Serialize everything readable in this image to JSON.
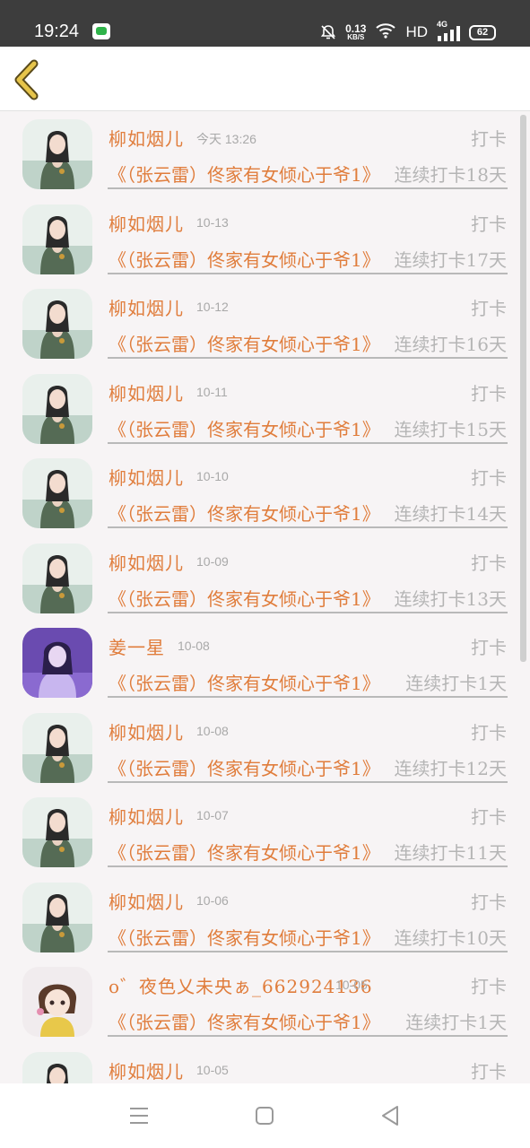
{
  "status_bar": {
    "time": "19:24",
    "net_speed_value": "0.13",
    "net_speed_unit": "KB/S",
    "hd": "HD",
    "network": "4G",
    "battery": "62"
  },
  "colors": {
    "accent": "#e07d3c",
    "muted": "#b5b5b5",
    "back_arrow": "#e6c44a"
  },
  "checkin_label": "打卡",
  "rows": [
    {
      "name": "柳如烟儿",
      "date": "今天 13:26",
      "title": "《（张云雷）佟家有女倾心于爷1》",
      "streak": "连续打卡18天",
      "avatar": "woman-portrait"
    },
    {
      "name": "柳如烟儿",
      "date": "10-13",
      "title": "《（张云雷）佟家有女倾心于爷1》",
      "streak": "连续打卡17天",
      "avatar": "woman-portrait"
    },
    {
      "name": "柳如烟儿",
      "date": "10-12",
      "title": "《（张云雷）佟家有女倾心于爷1》",
      "streak": "连续打卡16天",
      "avatar": "woman-portrait"
    },
    {
      "name": "柳如烟儿",
      "date": "10-11",
      "title": "《（张云雷）佟家有女倾心于爷1》",
      "streak": "连续打卡15天",
      "avatar": "woman-portrait"
    },
    {
      "name": "柳如烟儿",
      "date": "10-10",
      "title": "《（张云雷）佟家有女倾心于爷1》",
      "streak": "连续打卡14天",
      "avatar": "woman-portrait"
    },
    {
      "name": "柳如烟儿",
      "date": "10-09",
      "title": "《（张云雷）佟家有女倾心于爷1》",
      "streak": "连续打卡13天",
      "avatar": "woman-portrait"
    },
    {
      "name": "姜一星",
      "date": "10-08",
      "title": "《（张云雷）佟家有女倾心于爷1》",
      "streak": "连续打卡1天",
      "avatar": "purple-portrait"
    },
    {
      "name": "柳如烟儿",
      "date": "10-08",
      "title": "《（张云雷）佟家有女倾心于爷1》",
      "streak": "连续打卡12天",
      "avatar": "woman-portrait"
    },
    {
      "name": "柳如烟儿",
      "date": "10-07",
      "title": "《（张云雷）佟家有女倾心于爷1》",
      "streak": "连续打卡11天",
      "avatar": "woman-portrait"
    },
    {
      "name": "柳如烟儿",
      "date": "10-06",
      "title": "《（张云雷）佟家有女倾心于爷1》",
      "streak": "连续打卡10天",
      "avatar": "woman-portrait"
    },
    {
      "name": "o゛夜色乂未央ぁ_662924136",
      "date": "10-05",
      "title": "《（张云雷）佟家有女倾心于爷1》",
      "streak": "连续打卡1天",
      "avatar": "cartoon-portrait"
    },
    {
      "name": "柳如烟儿",
      "date": "10-05",
      "title": "",
      "streak": "",
      "avatar": "woman-portrait"
    }
  ]
}
